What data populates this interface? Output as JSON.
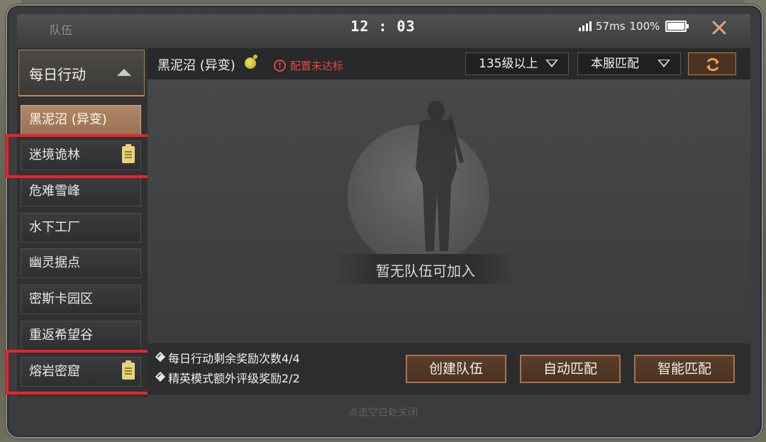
{
  "header": {
    "title": "队伍",
    "clock": "12 : 03",
    "ping": "57ms",
    "battery": "100%"
  },
  "sidebar": {
    "category": "每日行动",
    "items": [
      {
        "label": "黑泥沼 (异变)",
        "active": true,
        "badge": ""
      },
      {
        "label": "迷境诡林",
        "active": false,
        "badge": "clipboard-icon"
      },
      {
        "label": "危难雪峰",
        "active": false,
        "badge": ""
      },
      {
        "label": "水下工厂",
        "active": false,
        "badge": ""
      },
      {
        "label": "幽灵据点",
        "active": false,
        "badge": ""
      },
      {
        "label": "密斯卡园区",
        "active": false,
        "badge": ""
      },
      {
        "label": "重返希望谷",
        "active": false,
        "badge": ""
      },
      {
        "label": "熔岩密窟",
        "active": false,
        "badge": "clipboard-icon"
      }
    ]
  },
  "toolbar": {
    "map_name": "黑泥沼 (异变)",
    "warning": "配置未达标",
    "level_filter": "135级以上",
    "server_filter": "本服匹配"
  },
  "main": {
    "empty_text": "暂无队伍可加入"
  },
  "rewards": {
    "daily": "每日行动剩余奖励次数4/4",
    "elite": "精英模式额外评级奖励2/2"
  },
  "actions": {
    "create": "创建队伍",
    "auto": "自动匹配",
    "smart": "智能匹配"
  },
  "footer": {
    "hint": "点击空白处关闭"
  },
  "colors": {
    "accent": "#c47a3e",
    "highlight": "#e8232a",
    "warning": "#e14a3f"
  }
}
